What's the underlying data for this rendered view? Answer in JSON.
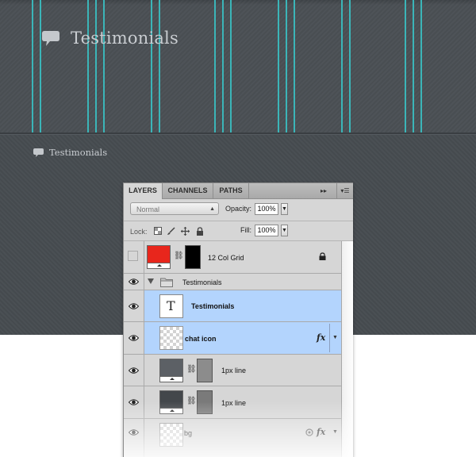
{
  "canvas": {
    "header_title": "Testimonials",
    "sub_title": "Testimonials",
    "guide_color": "#3bb5b8",
    "background_color": "#474c51"
  },
  "panel": {
    "tabs": [
      {
        "label": "LAYERS",
        "active": true
      },
      {
        "label": "CHANNELS",
        "active": false
      },
      {
        "label": "PATHS",
        "active": false
      }
    ],
    "blend_mode": "Normal",
    "opacity_label": "Opacity:",
    "opacity_value": "100%",
    "lock_label": "Lock:",
    "fill_label": "Fill:",
    "fill_value": "100%",
    "layers": [
      {
        "name": "12 Col Grid",
        "visible": false,
        "locked": true,
        "thumb_color": "#e8261c",
        "mask": true
      },
      {
        "name": "Testimonials",
        "type": "group",
        "visible": true,
        "expanded": true
      },
      {
        "name": "Testimonials",
        "type": "text",
        "visible": true,
        "selected": true,
        "thumb_glyph": "T"
      },
      {
        "name": "chat icon",
        "visible": true,
        "selected": true,
        "fx": "fx"
      },
      {
        "name": "1px line",
        "visible": true,
        "thumb_color": "#5c6065",
        "mask": true
      },
      {
        "name": "1px line",
        "visible": true,
        "thumb_color": "#43474b",
        "mask": true
      },
      {
        "name": "bg",
        "visible": true,
        "fx": "fx"
      }
    ],
    "selection_color": "#b3d4fd"
  }
}
